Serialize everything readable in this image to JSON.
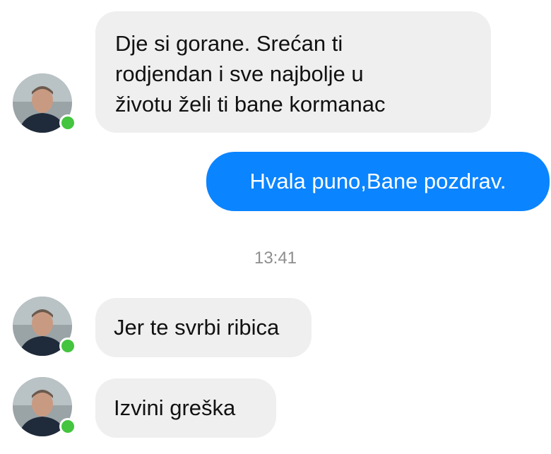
{
  "messages": [
    {
      "id": "m1",
      "direction": "incoming",
      "text": "Dje si gorane. Srećan ti\nrodjendan i sve najbolje u\nživotu želi ti bane kormanac"
    },
    {
      "id": "m2",
      "direction": "outgoing",
      "text": "Hvala puno,Bane pozdrav."
    },
    {
      "id": "m3",
      "direction": "incoming",
      "text": "Jer te svrbi ribica"
    },
    {
      "id": "m4",
      "direction": "incoming",
      "text": "Izvini greška"
    }
  ],
  "timestamp": "13:41",
  "avatar": {
    "icon": "contact-avatar",
    "status": "online"
  },
  "colors": {
    "incoming_bubble": "#efefef",
    "outgoing_bubble": "#0b84ff",
    "online_dot": "#44c43f",
    "timestamp_text": "#8e8e8e"
  }
}
